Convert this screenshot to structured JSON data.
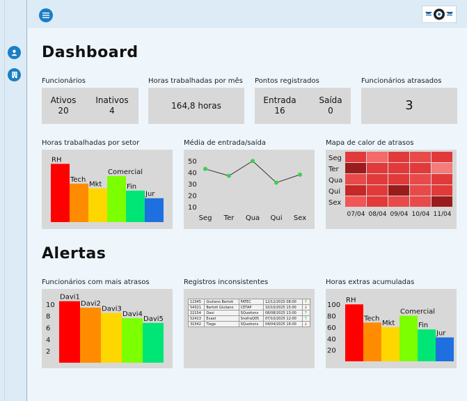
{
  "header": {
    "menu_icon": "menu-icon",
    "logo_icon": "wheel-logo-icon"
  },
  "sidebar": {
    "items": [
      {
        "icon": "user-icon"
      },
      {
        "icon": "building-icon"
      }
    ]
  },
  "dashboard": {
    "title": "Dashboard",
    "kpis": {
      "funcionarios": {
        "label": "Funcionários",
        "ativos_label": "Ativos",
        "ativos_value": "20",
        "inativos_label": "Inativos",
        "inativos_value": "4"
      },
      "horas": {
        "label": "Horas trabalhadas por mês",
        "value": "164,8 horas"
      },
      "pontos": {
        "label": "Pontos registrados",
        "entrada_label": "Entrada",
        "entrada_value": "16",
        "saida_label": "Saída",
        "saida_value": "0"
      },
      "atrasados": {
        "label": "Funcionários atrasados",
        "value": "3"
      }
    }
  },
  "alertas": {
    "title": "Alertas",
    "mais_atrasos_label": "Funcionários com mais atrasos",
    "inconsistentes_label": "Registros inconsistentes",
    "extras_label": "Horas extras acumuladas",
    "registros": [
      {
        "id": "12345",
        "nome": "Giuliano Bertoti",
        "org": "FATEC",
        "data": "12/12/2025 08:00",
        "dir": "up"
      },
      {
        "id": "54321",
        "nome": "Bertoti Giuliano",
        "org": "CETAP",
        "data": "10/10/2025 15:00",
        "dir": "down"
      },
      {
        "id": "22154",
        "nome": "Davi",
        "org": "SQuotions",
        "data": "08/08/2025 13:00",
        "dir": "up"
      },
      {
        "id": "52413",
        "nome": "Evael",
        "org": "SnofraQ05",
        "data": "07/10/2025 12:00",
        "dir": "up"
      },
      {
        "id": "31542",
        "nome": "Tiago",
        "org": "SQuotions",
        "data": "04/04/2025 16:00",
        "dir": "down"
      }
    ]
  },
  "colors": {
    "accent": "#1a7fc4",
    "card": "#d8d8d8",
    "up": "#2eb82e",
    "down": "#d62020"
  },
  "chart_data": [
    {
      "id": "horas-setor",
      "type": "bar",
      "title": "Horas trabalhadas por setor",
      "categories": [
        "RH",
        "Tech",
        "Mkt",
        "Comercial",
        "Fin",
        "Jur"
      ],
      "values": [
        100,
        66,
        58,
        79,
        54,
        41
      ],
      "ylim": [
        0,
        110
      ],
      "colors": [
        "#ff0000",
        "#ff8c00",
        "#ffd700",
        "#7cff00",
        "#00e676",
        "#1e6fe0"
      ]
    },
    {
      "id": "media-entrada-saida",
      "type": "line",
      "title": "Média de entrada/saída",
      "categories": [
        "Seg",
        "Ter",
        "Qua",
        "Qui",
        "Sex"
      ],
      "values": [
        43,
        37,
        50,
        31,
        38
      ],
      "yticks": [
        10,
        20,
        30,
        40,
        50
      ],
      "ylim": [
        5,
        55
      ]
    },
    {
      "id": "mapa-calor",
      "type": "heatmap",
      "title": "Mapa de calor de atrasos",
      "rows": [
        "Seg",
        "Ter",
        "Qua",
        "Qui",
        "Sex"
      ],
      "columns": [
        "07/04",
        "08/04",
        "09/04",
        "10/04",
        "11/04"
      ],
      "cells": [
        [
          "#e23a3a",
          "#f26a6a",
          "#e23a3a",
          "#e84a4a",
          "#e23a3a"
        ],
        [
          "#9b1c1c",
          "#e23a3a",
          "#e23a3a",
          "#e23a3a",
          "#f47c7c"
        ],
        [
          "#e84a4a",
          "#e23a3a",
          "#e23a3a",
          "#e84a4a",
          "#e23a3a"
        ],
        [
          "#c62828",
          "#e23a3a",
          "#9b1c1c",
          "#e84a4a",
          "#e23a3a"
        ],
        [
          "#f25555",
          "#e23a3a",
          "#e84a4a",
          "#e84a4a",
          "#9b1c1c"
        ]
      ]
    },
    {
      "id": "mais-atrasos",
      "type": "bar",
      "title": "Funcionários com mais atrasos",
      "categories": [
        "Davi1",
        "Davi2",
        "Davi3",
        "Davi4",
        "Davi5"
      ],
      "values": [
        10.5,
        9.4,
        8.5,
        7.6,
        6.8
      ],
      "yticks": [
        2,
        4,
        6,
        8,
        10
      ],
      "ylim": [
        0,
        12
      ],
      "colors": [
        "#ff0000",
        "#ff8c00",
        "#ffd700",
        "#7cff00",
        "#00e676"
      ]
    },
    {
      "id": "horas-extras",
      "type": "bar",
      "title": "Horas extras acumuladas",
      "categories": [
        "RH",
        "Tech",
        "Mkt",
        "Comercial",
        "Fin",
        "Jur"
      ],
      "values": [
        100,
        68,
        60,
        80,
        56,
        42
      ],
      "yticks": [
        20,
        40,
        60,
        80,
        100
      ],
      "ylim": [
        0,
        110
      ],
      "colors": [
        "#ff0000",
        "#ff8c00",
        "#ffd700",
        "#7cff00",
        "#00e676",
        "#1e6fe0"
      ]
    }
  ]
}
